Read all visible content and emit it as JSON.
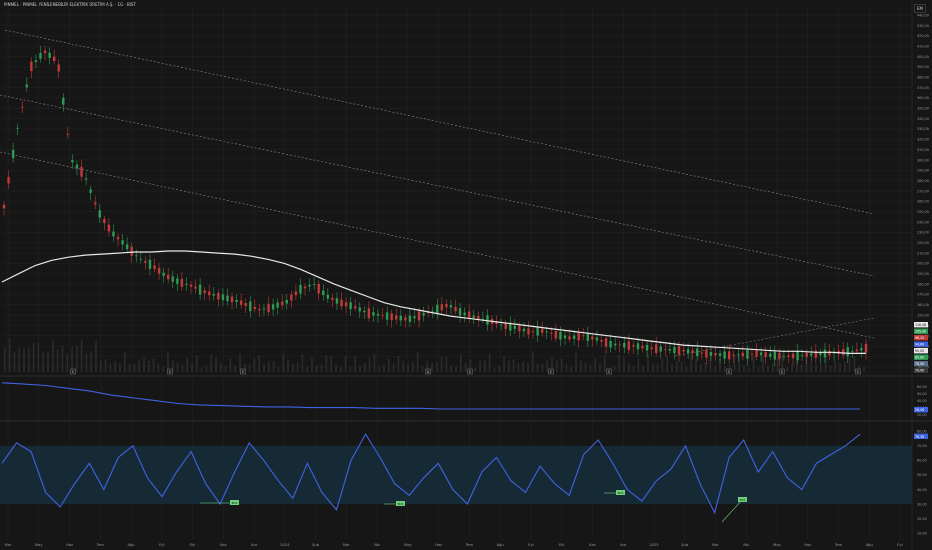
{
  "header": {
    "title": "PINMEL · PINMEL YENİLENEBİLİR ELEKTRİK ÜRETİM A.Ş. · 1G · BIST",
    "scale_button": "EM"
  },
  "colors": {
    "background": "#161616",
    "grid": "#242424",
    "candle_up": "#2e9b52",
    "candle_down": "#c23a3a",
    "sma_line": "#e8e8e8",
    "channel_lines": "#8a8a8a",
    "indicator_line": "#3f63e0",
    "rsi_band": "#17303f",
    "signal_label": "#6fcf7a"
  },
  "chart_data": [
    {
      "type": "line",
      "panel": "price",
      "x_ticks": [
        "Mar",
        "May",
        "Haz",
        "Tem",
        "Ağu",
        "Eyl",
        "Eki",
        "Kas",
        "Ara",
        "2024",
        "Şub",
        "Mar",
        "Nis",
        "May",
        "Haz",
        "Tem",
        "Ağu",
        "Eyl",
        "Eki",
        "Kas",
        "Ara",
        "2025",
        "Şub",
        "Mar",
        "Nis",
        "May",
        "Haz",
        "Tem",
        "Ağu",
        "Eyl"
      ],
      "y_ticks": [
        "440,00",
        "430,00",
        "420,00",
        "410,00",
        "400,00",
        "390,00",
        "380,00",
        "370,00",
        "360,00",
        "350,00",
        "340,00",
        "330,00",
        "320,00",
        "310,00",
        "300,00",
        "290,00",
        "280,00",
        "270,00",
        "260,00",
        "250,00",
        "240,00",
        "230,00",
        "220,00",
        "210,00",
        "200,00",
        "190,00",
        "180,00",
        "170,00",
        "160,00",
        "150,00",
        "140,00",
        "130,00",
        "120,00",
        "110,00",
        "100,00"
      ],
      "ylim": [
        95,
        445
      ],
      "series": [
        {
          "role": "price",
          "values": [
            255,
            330,
            390,
            405,
            395,
            300,
            285,
            250,
            230,
            218,
            205,
            198,
            188,
            182,
            178,
            172,
            168,
            165,
            160,
            155,
            158,
            163,
            175,
            180,
            168,
            162,
            158,
            152,
            150,
            148,
            146,
            150,
            155,
            160,
            152,
            148,
            145,
            140,
            138,
            134,
            135,
            131,
            128,
            130,
            127,
            122,
            121,
            120,
            118,
            117,
            116,
            115,
            113,
            112,
            111,
            112,
            113,
            111,
            110,
            111,
            112,
            113,
            114,
            115,
            118
          ]
        },
        {
          "role": "moving-average",
          "values": [
            182,
            190,
            198,
            203,
            206,
            208,
            209,
            210,
            211,
            211,
            212,
            212,
            211,
            210,
            209,
            207,
            204,
            200,
            194,
            187,
            180,
            174,
            168,
            162,
            158,
            155,
            152,
            149,
            147,
            145,
            143,
            141,
            139,
            137,
            135,
            133,
            131,
            129,
            127,
            125,
            123,
            121,
            120,
            119,
            118,
            117,
            116,
            115,
            115,
            114,
            114,
            113,
            113
          ]
        }
      ],
      "event_markers": [
        "E",
        "E",
        "E",
        "D",
        "E",
        "E",
        "E",
        "E",
        "E",
        "E"
      ],
      "price_labels": [
        "116,48",
        "105,90",
        "98,20",
        "94,60",
        "90,00",
        "85,80",
        "78,90",
        "79,90"
      ]
    },
    {
      "type": "line",
      "panel": "indicator",
      "y_ticks": [
        "60,00",
        "50,00",
        "40,00",
        "30,00",
        "20,00"
      ],
      "ylim": [
        15,
        70
      ],
      "series": [
        {
          "values": [
            66,
            64,
            62,
            58,
            54,
            48,
            44,
            40,
            36,
            34,
            33,
            32,
            31,
            31,
            30,
            30,
            30,
            29,
            29,
            29,
            28,
            28,
            28,
            28,
            28,
            28,
            28,
            28,
            28,
            28,
            28,
            28,
            28,
            28,
            28,
            28,
            28,
            28,
            28,
            28
          ]
        }
      ],
      "last_value_label": "26,56"
    },
    {
      "type": "line",
      "panel": "rsi",
      "y_ticks": [
        "80,00",
        "70,00",
        "60,00",
        "50,00",
        "40,00",
        "30,00",
        "20,00",
        "10,00"
      ],
      "ylim": [
        8,
        85
      ],
      "band": [
        30,
        70
      ],
      "series": [
        {
          "values": [
            58,
            72,
            66,
            38,
            28,
            44,
            58,
            40,
            62,
            70,
            48,
            35,
            52,
            66,
            44,
            30,
            52,
            72,
            60,
            46,
            34,
            58,
            38,
            26,
            60,
            78,
            62,
            44,
            36,
            48,
            58,
            40,
            30,
            52,
            62,
            46,
            38,
            56,
            44,
            36,
            64,
            74,
            58,
            40,
            32,
            46,
            54,
            70,
            44,
            24,
            62,
            74,
            52,
            66,
            48,
            40,
            58,
            64,
            70,
            78
          ]
        }
      ],
      "signal_labels": [
        "BOS",
        "BOS",
        "BOS",
        "BOS"
      ],
      "last_value_label": "76,36"
    }
  ]
}
